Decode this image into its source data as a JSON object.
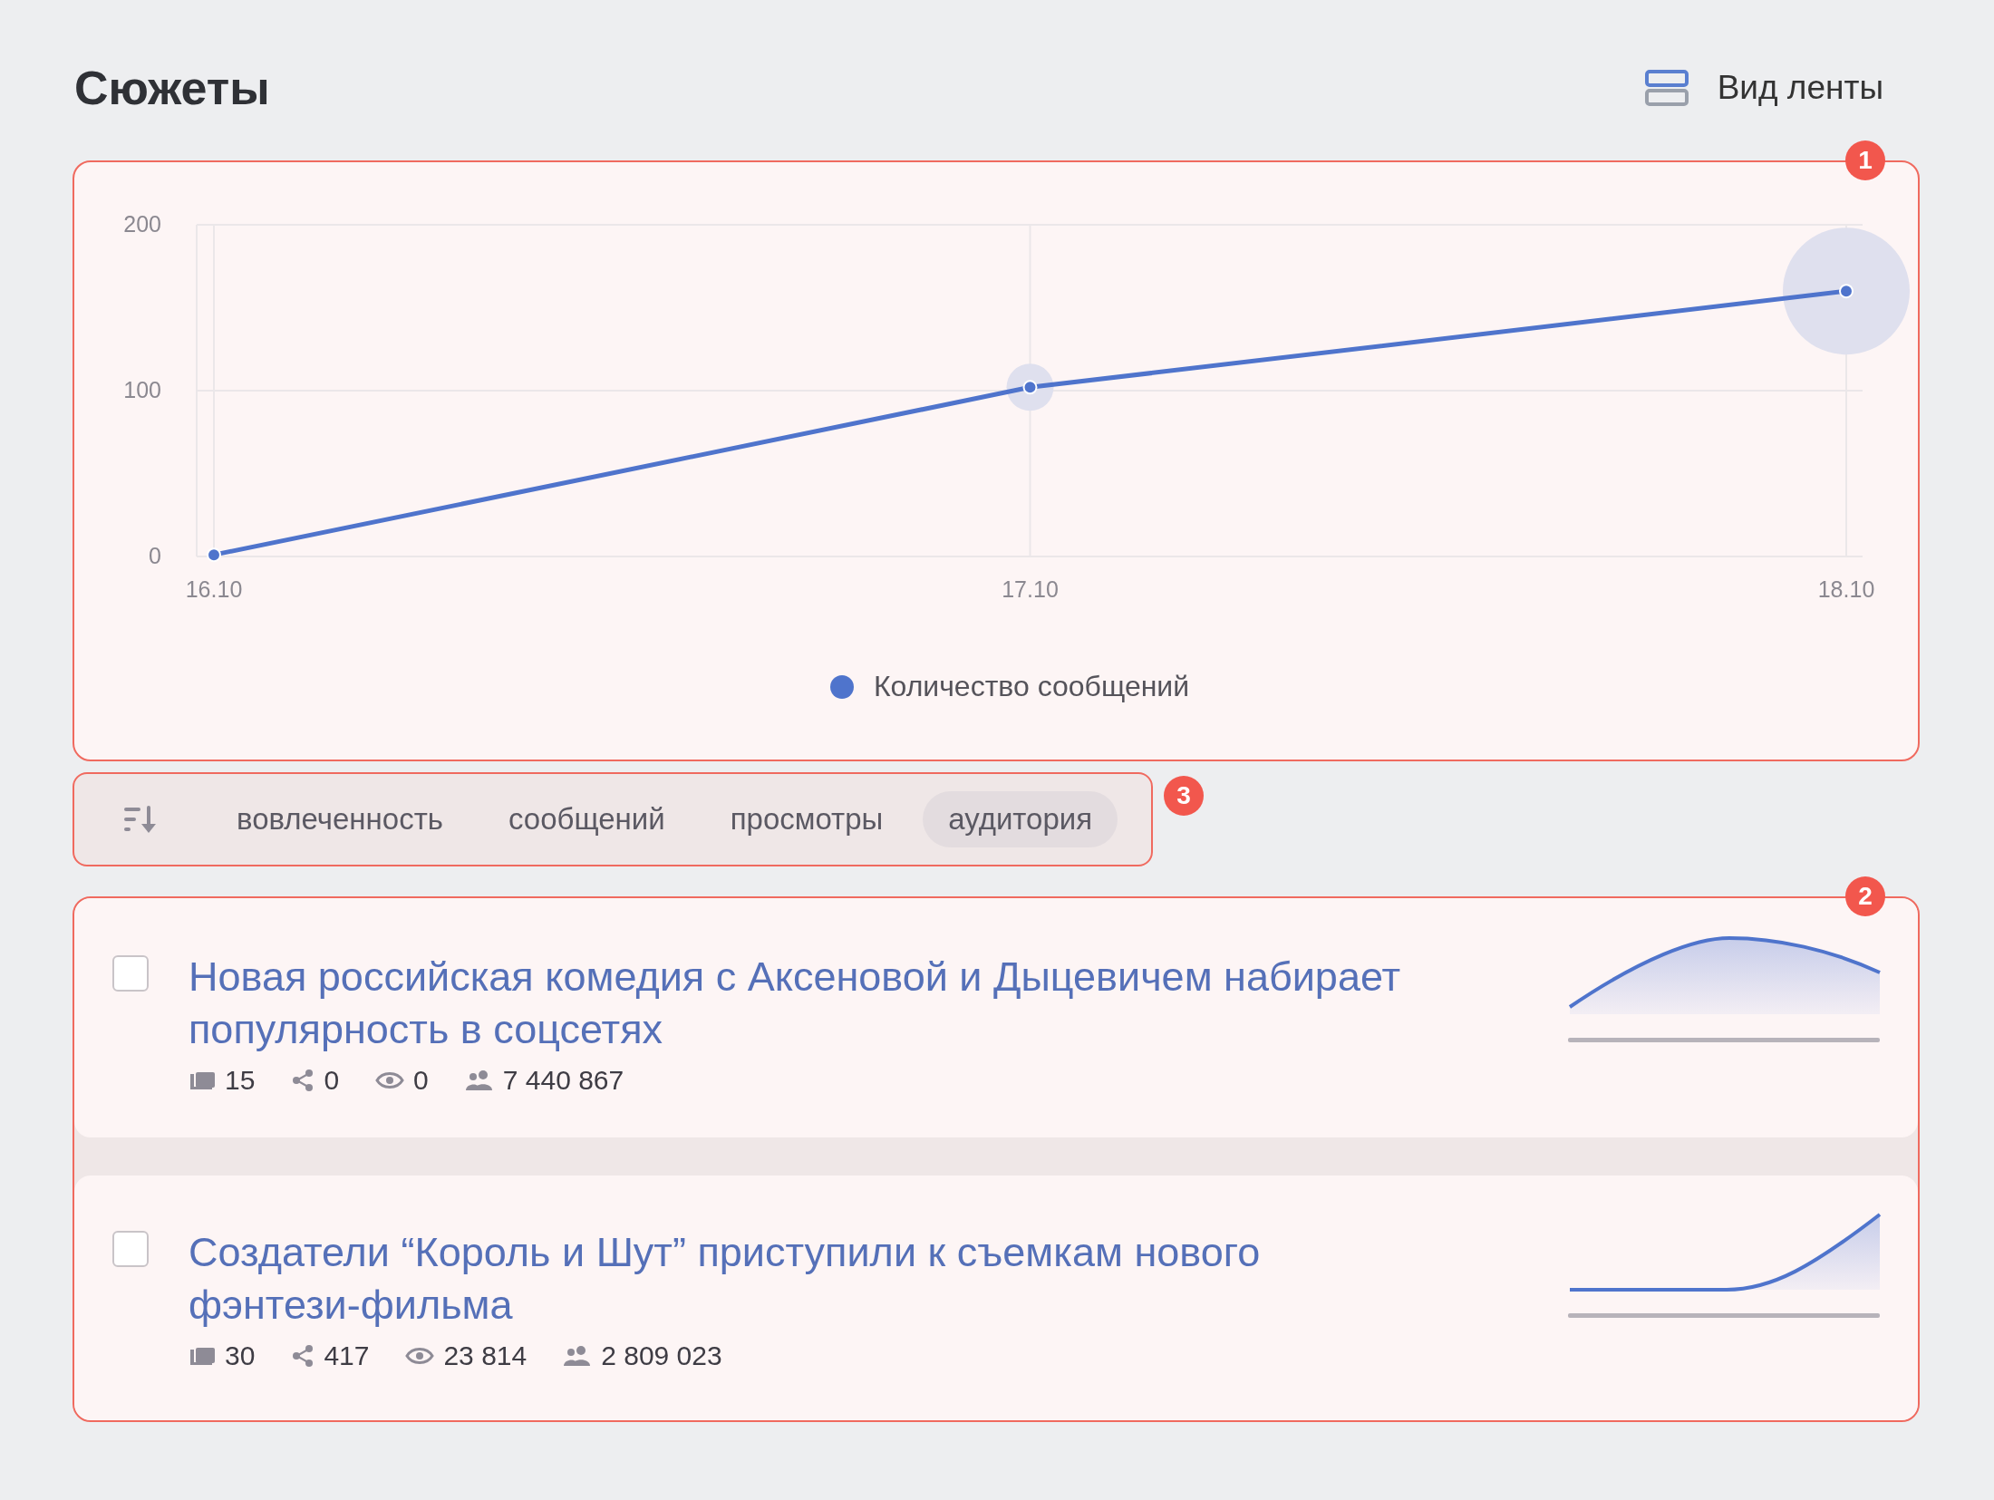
{
  "header": {
    "title": "Сюжеты",
    "view_button": "Вид ленты"
  },
  "chart_panel": {
    "badge": "1",
    "chart_data": {
      "type": "line",
      "categories": [
        "16.10",
        "17.10",
        "18.10"
      ],
      "yticks": [
        0,
        100,
        200
      ],
      "ylim": [
        0,
        200
      ],
      "grid": true,
      "series": [
        {
          "name": "Количество сообщений",
          "color": "#4f74cc",
          "marker": "circle",
          "values": [
            1,
            102,
            160
          ]
        }
      ]
    }
  },
  "sort_bar": {
    "badge": "3",
    "options": [
      {
        "label": "вовлеченность",
        "selected": false
      },
      {
        "label": "сообщений",
        "selected": false
      },
      {
        "label": "просмотры",
        "selected": false
      },
      {
        "label": "аудитория",
        "selected": true
      }
    ]
  },
  "stories": {
    "badge": "2",
    "items": [
      {
        "title": "Новая российская комедия с Аксеновой и Дыцевичем набирает популярность в соцсетях",
        "checked": false,
        "kind": "peak",
        "stats": [
          {
            "kind": "messages",
            "value": "15"
          },
          {
            "kind": "shares",
            "value": "0"
          },
          {
            "kind": "views",
            "value": "0"
          },
          {
            "kind": "audience",
            "value": "7 440 867"
          }
        ]
      },
      {
        "title": "Создатели “Король и Шут” приступили к съемкам нового фэнтези-фильма",
        "checked": false,
        "kind": "rise",
        "stats": [
          {
            "kind": "messages",
            "value": "30"
          },
          {
            "kind": "shares",
            "value": "417"
          },
          {
            "kind": "views",
            "value": "23 814"
          },
          {
            "kind": "audience",
            "value": "2 809 023"
          }
        ]
      }
    ]
  }
}
